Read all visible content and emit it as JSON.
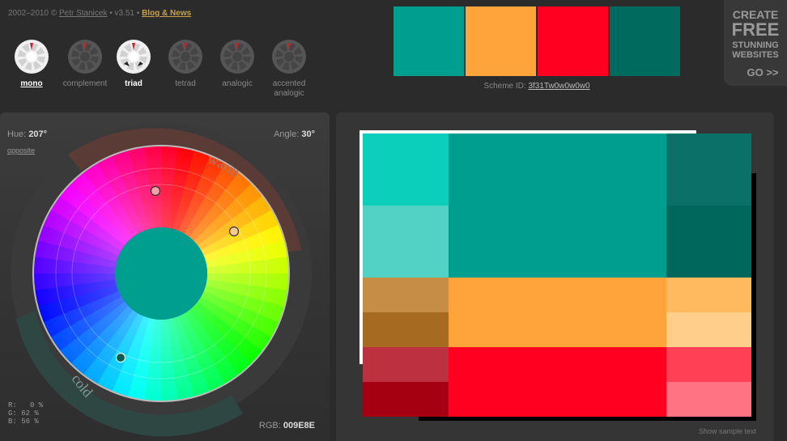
{
  "credit": {
    "years": "2002–2010 ©",
    "author": "Petr Stanicek",
    "sep": " • v3.51 •",
    "blog": "Blog & News"
  },
  "modes": [
    {
      "label": "mono",
      "active": true,
      "current": true
    },
    {
      "label": "complement",
      "active": false,
      "current": false
    },
    {
      "label": "triad",
      "active": true,
      "current": false
    },
    {
      "label": "tetrad",
      "active": false,
      "current": false
    },
    {
      "label": "analogic",
      "active": false,
      "current": false
    },
    {
      "label": "accented analogic",
      "active": false,
      "current": false
    }
  ],
  "scheme": {
    "swatches": [
      "#009E8E",
      "#FFA33A",
      "#FF0020",
      "#006A5E"
    ],
    "id_label": "Scheme ID:",
    "id_value": "3f31Tw0w0w0w0"
  },
  "ad": {
    "line1": "CREATE",
    "line2": "FREE",
    "line3": "STUNNING",
    "line4": "WEBSITES",
    "go": "GO >>"
  },
  "wheel": {
    "hue_label": "Hue:",
    "hue_value": "207°",
    "angle_label": "Angle:",
    "angle_value": "30°",
    "opposite": "opposite",
    "warm": "warm",
    "cold": "cold",
    "r_text": "R:   0 %",
    "g_text": "G: 62 %",
    "b_text": "B: 56 %",
    "rgb_label": "RGB:",
    "rgb_value": "009E8E",
    "center_color": "#009E8E"
  },
  "palette": {
    "show_sample": "Show sample text",
    "groups": [
      {
        "name": "primary",
        "main": "#009E8E",
        "top_left": "#0CCFBB",
        "bottom_left": "#52D2C5",
        "top_right": "#0B7168",
        "bottom_right": "#00675C"
      },
      {
        "name": "secondary-1",
        "main": "#FFA33A",
        "top_left": "#C68D46",
        "bottom_left": "#A66A20",
        "top_right": "#FFB95F",
        "bottom_right": "#FFCE8A"
      },
      {
        "name": "secondary-2",
        "main": "#FF0020",
        "top_left": "#BD3040",
        "bottom_left": "#A50012",
        "top_right": "#FF4055",
        "bottom_right": "#FF7383"
      }
    ]
  }
}
